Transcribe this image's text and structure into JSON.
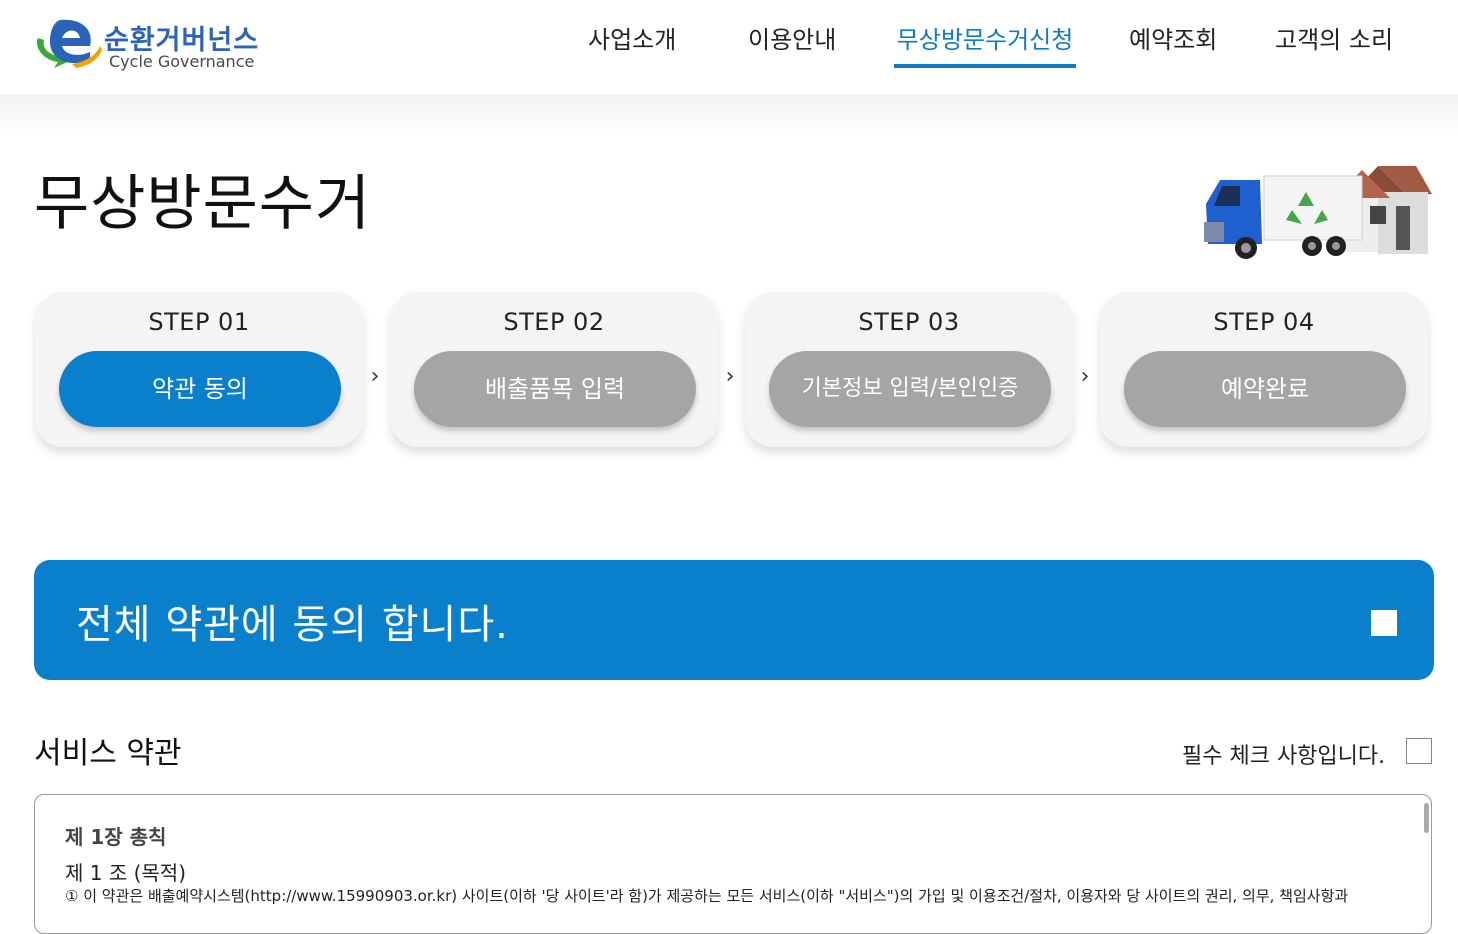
{
  "brand": {
    "name_kr": "순환거버넌스",
    "name_en": "Cycle Governance"
  },
  "nav": {
    "items": [
      {
        "label": "사업소개",
        "active": false
      },
      {
        "label": "이용안내",
        "active": false
      },
      {
        "label": "무상방문수거신청",
        "active": true
      },
      {
        "label": "예약조회",
        "active": false
      },
      {
        "label": "고객의 소리",
        "active": false
      }
    ]
  },
  "page": {
    "title": "무상방문수거"
  },
  "steps": [
    {
      "label": "STEP 01",
      "action": "약관 동의",
      "active": true
    },
    {
      "label": "STEP 02",
      "action": "배출품목 입력",
      "active": false
    },
    {
      "label": "STEP 03",
      "action": "기본정보 입력/본인인증",
      "active": false
    },
    {
      "label": "STEP 04",
      "action": "예약완료",
      "active": false
    }
  ],
  "step_arrow": "›",
  "agree_all": {
    "label": "전체 약관에 동의 합니다.",
    "checked": false
  },
  "terms": {
    "heading": "서비스 약관",
    "required_label": "필수 체크 사항입니다.",
    "required_checked": false,
    "chapter": "제 1장 총칙",
    "article": "제 1 조 (목적)",
    "clause": "① 이 약관은 배출예약시스템(http://www.15990903.or.kr) 사이트(이하 '당 사이트'라 함)가 제공하는 모든 서비스(이하 \"서비스\")의 가입 및 이용조건/절차, 이용자와 당 사이트의 권리, 의무, 책임사항과"
  },
  "colors": {
    "primary": "#0a7fcb",
    "inactive_pill": "#a5a5a5",
    "logo_blue": "#2a63b8",
    "logo_green": "#3aaa35"
  },
  "icons": {
    "logo": "e-logo-icon",
    "illustration": "recycling-truck-house-icon",
    "arrow": "chevron-right-icon"
  }
}
